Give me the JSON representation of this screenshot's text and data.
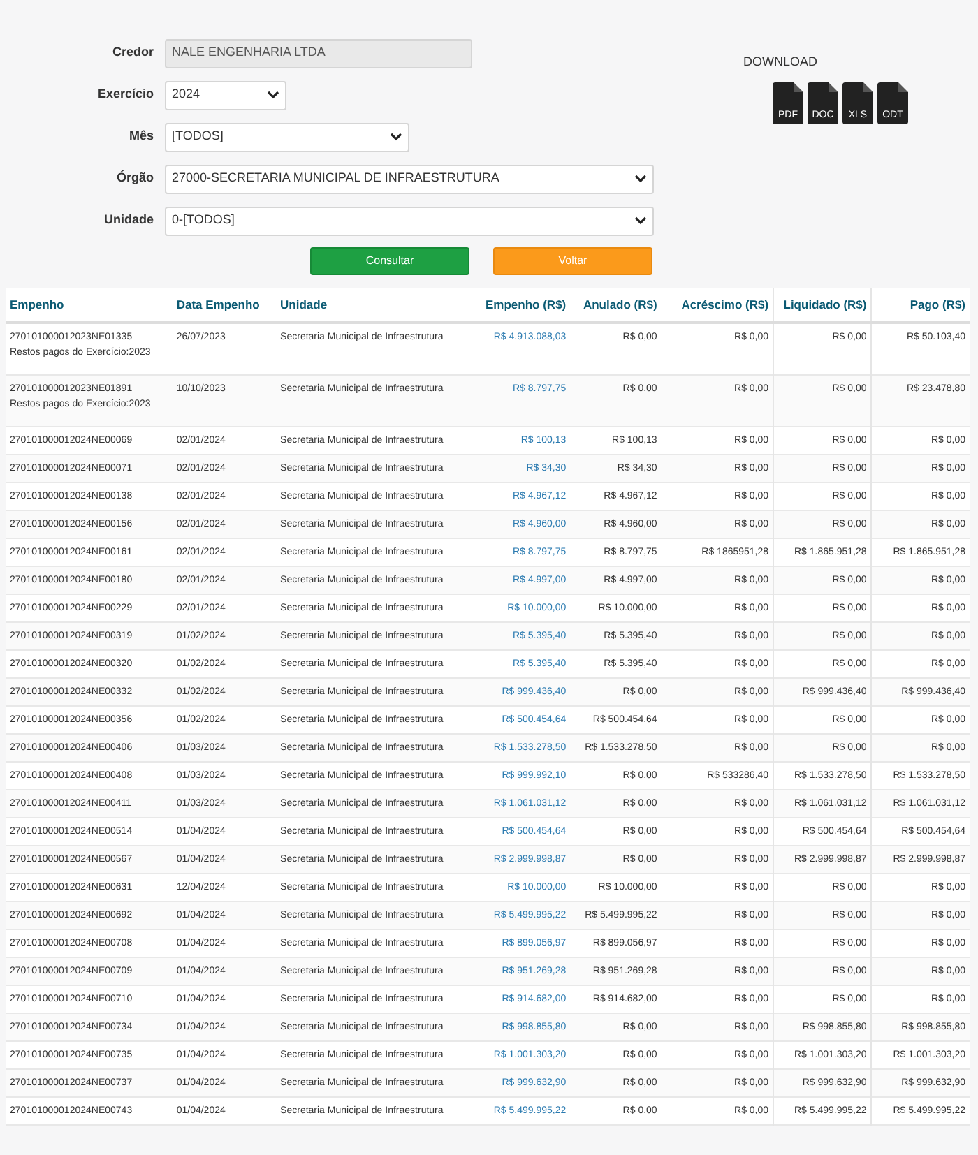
{
  "form": {
    "fields": [
      {
        "kind": "readonly",
        "label": "Credor",
        "value": "NALE ENGENHARIA LTDA"
      },
      {
        "kind": "select",
        "label": "Exercício",
        "value": "2024"
      },
      {
        "kind": "select",
        "label": "Mês",
        "value": "[TODOS]"
      },
      {
        "kind": "select",
        "label": "Órgão",
        "value": "27000-SECRETARIA MUNICIPAL DE INFRAESTRUTURA"
      },
      {
        "kind": "select",
        "label": "Unidade",
        "value": "0-[TODOS]"
      }
    ],
    "buttons": [
      {
        "label": "Consultar",
        "kind": "primary"
      },
      {
        "label": "Voltar",
        "kind": "secondary"
      }
    ]
  },
  "download": {
    "title": "DOWNLOAD",
    "formats": [
      "PDF",
      "DOC",
      "XLS",
      "ODT"
    ]
  },
  "table": {
    "columns": [
      "Empenho",
      "Data Empenho",
      "Unidade",
      "Empenho (R$)",
      "Anulado (R$)",
      "Acréscimo (R$)",
      "Liquidado (R$)",
      "Pago (R$)"
    ],
    "rows": [
      {
        "empenho": "270101000012023NE01335",
        "note": "Restos pagos do Exercício:2023",
        "data": "26/07/2023",
        "unidade": "Secretaria Municipal de Infraestrutura",
        "valor": "R$ 4.913.088,03",
        "anulado": "R$ 0,00",
        "acrescimo": "R$ 0,00",
        "liquidado": "R$ 0,00",
        "pago": "R$ 50.103,40"
      },
      {
        "empenho": "270101000012023NE01891",
        "note": "Restos pagos do Exercício:2023",
        "data": "10/10/2023",
        "unidade": "Secretaria Municipal de Infraestrutura",
        "valor": "R$ 8.797,75",
        "anulado": "R$ 0,00",
        "acrescimo": "R$ 0,00",
        "liquidado": "R$ 0,00",
        "pago": "R$ 23.478,80"
      },
      {
        "empenho": "270101000012024NE00069",
        "data": "02/01/2024",
        "unidade": "Secretaria Municipal de Infraestrutura",
        "valor": "R$ 100,13",
        "anulado": "R$ 100,13",
        "acrescimo": "R$ 0,00",
        "liquidado": "R$ 0,00",
        "pago": "R$ 0,00"
      },
      {
        "empenho": "270101000012024NE00071",
        "data": "02/01/2024",
        "unidade": "Secretaria Municipal de Infraestrutura",
        "valor": "R$ 34,30",
        "anulado": "R$ 34,30",
        "acrescimo": "R$ 0,00",
        "liquidado": "R$ 0,00",
        "pago": "R$ 0,00"
      },
      {
        "empenho": "270101000012024NE00138",
        "data": "02/01/2024",
        "unidade": "Secretaria Municipal de Infraestrutura",
        "valor": "R$ 4.967,12",
        "anulado": "R$ 4.967,12",
        "acrescimo": "R$ 0,00",
        "liquidado": "R$ 0,00",
        "pago": "R$ 0,00"
      },
      {
        "empenho": "270101000012024NE00156",
        "data": "02/01/2024",
        "unidade": "Secretaria Municipal de Infraestrutura",
        "valor": "R$ 4.960,00",
        "anulado": "R$ 4.960,00",
        "acrescimo": "R$ 0,00",
        "liquidado": "R$ 0,00",
        "pago": "R$ 0,00"
      },
      {
        "empenho": "270101000012024NE00161",
        "data": "02/01/2024",
        "unidade": "Secretaria Municipal de Infraestrutura",
        "valor": "R$ 8.797,75",
        "anulado": "R$ 8.797,75",
        "acrescimo": "R$ 1865951,28",
        "liquidado": "R$ 1.865.951,28",
        "pago": "R$ 1.865.951,28"
      },
      {
        "empenho": "270101000012024NE00180",
        "data": "02/01/2024",
        "unidade": "Secretaria Municipal de Infraestrutura",
        "valor": "R$ 4.997,00",
        "anulado": "R$ 4.997,00",
        "acrescimo": "R$ 0,00",
        "liquidado": "R$ 0,00",
        "pago": "R$ 0,00"
      },
      {
        "empenho": "270101000012024NE00229",
        "data": "02/01/2024",
        "unidade": "Secretaria Municipal de Infraestrutura",
        "valor": "R$ 10.000,00",
        "anulado": "R$ 10.000,00",
        "acrescimo": "R$ 0,00",
        "liquidado": "R$ 0,00",
        "pago": "R$ 0,00"
      },
      {
        "empenho": "270101000012024NE00319",
        "data": "01/02/2024",
        "unidade": "Secretaria Municipal de Infraestrutura",
        "valor": "R$ 5.395,40",
        "anulado": "R$ 5.395,40",
        "acrescimo": "R$ 0,00",
        "liquidado": "R$ 0,00",
        "pago": "R$ 0,00"
      },
      {
        "empenho": "270101000012024NE00320",
        "data": "01/02/2024",
        "unidade": "Secretaria Municipal de Infraestrutura",
        "valor": "R$ 5.395,40",
        "anulado": "R$ 5.395,40",
        "acrescimo": "R$ 0,00",
        "liquidado": "R$ 0,00",
        "pago": "R$ 0,00"
      },
      {
        "empenho": "270101000012024NE00332",
        "data": "01/02/2024",
        "unidade": "Secretaria Municipal de Infraestrutura",
        "valor": "R$ 999.436,40",
        "anulado": "R$ 0,00",
        "acrescimo": "R$ 0,00",
        "liquidado": "R$ 999.436,40",
        "pago": "R$ 999.436,40"
      },
      {
        "empenho": "270101000012024NE00356",
        "data": "01/02/2024",
        "unidade": "Secretaria Municipal de Infraestrutura",
        "valor": "R$ 500.454,64",
        "anulado": "R$ 500.454,64",
        "acrescimo": "R$ 0,00",
        "liquidado": "R$ 0,00",
        "pago": "R$ 0,00"
      },
      {
        "empenho": "270101000012024NE00406",
        "data": "01/03/2024",
        "unidade": "Secretaria Municipal de Infraestrutura",
        "valor": "R$ 1.533.278,50",
        "anulado": "R$ 1.533.278,50",
        "acrescimo": "R$ 0,00",
        "liquidado": "R$ 0,00",
        "pago": "R$ 0,00"
      },
      {
        "empenho": "270101000012024NE00408",
        "data": "01/03/2024",
        "unidade": "Secretaria Municipal de Infraestrutura",
        "valor": "R$ 999.992,10",
        "anulado": "R$ 0,00",
        "acrescimo": "R$ 533286,40",
        "liquidado": "R$ 1.533.278,50",
        "pago": "R$ 1.533.278,50"
      },
      {
        "empenho": "270101000012024NE00411",
        "data": "01/03/2024",
        "unidade": "Secretaria Municipal de Infraestrutura",
        "valor": "R$ 1.061.031,12",
        "anulado": "R$ 0,00",
        "acrescimo": "R$ 0,00",
        "liquidado": "R$ 1.061.031,12",
        "pago": "R$ 1.061.031,12"
      },
      {
        "empenho": "270101000012024NE00514",
        "data": "01/04/2024",
        "unidade": "Secretaria Municipal de Infraestrutura",
        "valor": "R$ 500.454,64",
        "anulado": "R$ 0,00",
        "acrescimo": "R$ 0,00",
        "liquidado": "R$ 500.454,64",
        "pago": "R$ 500.454,64"
      },
      {
        "empenho": "270101000012024NE00567",
        "data": "01/04/2024",
        "unidade": "Secretaria Municipal de Infraestrutura",
        "valor": "R$ 2.999.998,87",
        "anulado": "R$ 0,00",
        "acrescimo": "R$ 0,00",
        "liquidado": "R$ 2.999.998,87",
        "pago": "R$ 2.999.998,87"
      },
      {
        "empenho": "270101000012024NE00631",
        "data": "12/04/2024",
        "unidade": "Secretaria Municipal de Infraestrutura",
        "valor": "R$ 10.000,00",
        "anulado": "R$ 10.000,00",
        "acrescimo": "R$ 0,00",
        "liquidado": "R$ 0,00",
        "pago": "R$ 0,00"
      },
      {
        "empenho": "270101000012024NE00692",
        "data": "01/04/2024",
        "unidade": "Secretaria Municipal de Infraestrutura",
        "valor": "R$ 5.499.995,22",
        "anulado": "R$ 5.499.995,22",
        "acrescimo": "R$ 0,00",
        "liquidado": "R$ 0,00",
        "pago": "R$ 0,00"
      },
      {
        "empenho": "270101000012024NE00708",
        "data": "01/04/2024",
        "unidade": "Secretaria Municipal de Infraestrutura",
        "valor": "R$ 899.056,97",
        "anulado": "R$ 899.056,97",
        "acrescimo": "R$ 0,00",
        "liquidado": "R$ 0,00",
        "pago": "R$ 0,00"
      },
      {
        "empenho": "270101000012024NE00709",
        "data": "01/04/2024",
        "unidade": "Secretaria Municipal de Infraestrutura",
        "valor": "R$ 951.269,28",
        "anulado": "R$ 951.269,28",
        "acrescimo": "R$ 0,00",
        "liquidado": "R$ 0,00",
        "pago": "R$ 0,00"
      },
      {
        "empenho": "270101000012024NE00710",
        "data": "01/04/2024",
        "unidade": "Secretaria Municipal de Infraestrutura",
        "valor": "R$ 914.682,00",
        "anulado": "R$ 914.682,00",
        "acrescimo": "R$ 0,00",
        "liquidado": "R$ 0,00",
        "pago": "R$ 0,00"
      },
      {
        "empenho": "270101000012024NE00734",
        "data": "01/04/2024",
        "unidade": "Secretaria Municipal de Infraestrutura",
        "valor": "R$ 998.855,80",
        "anulado": "R$ 0,00",
        "acrescimo": "R$ 0,00",
        "liquidado": "R$ 998.855,80",
        "pago": "R$ 998.855,80"
      },
      {
        "empenho": "270101000012024NE00735",
        "data": "01/04/2024",
        "unidade": "Secretaria Municipal de Infraestrutura",
        "valor": "R$ 1.001.303,20",
        "anulado": "R$ 0,00",
        "acrescimo": "R$ 0,00",
        "liquidado": "R$ 1.001.303,20",
        "pago": "R$ 1.001.303,20"
      },
      {
        "empenho": "270101000012024NE00737",
        "data": "01/04/2024",
        "unidade": "Secretaria Municipal de Infraestrutura",
        "valor": "R$ 999.632,90",
        "anulado": "R$ 0,00",
        "acrescimo": "R$ 0,00",
        "liquidado": "R$ 999.632,90",
        "pago": "R$ 999.632,90"
      },
      {
        "empenho": "270101000012024NE00743",
        "data": "01/04/2024",
        "unidade": "Secretaria Municipal de Infraestrutura",
        "valor": "R$ 5.499.995,22",
        "anulado": "R$ 0,00",
        "acrescimo": "R$ 0,00",
        "liquidado": "R$ 5.499.995,22",
        "pago": "R$ 5.499.995,22"
      }
    ]
  }
}
